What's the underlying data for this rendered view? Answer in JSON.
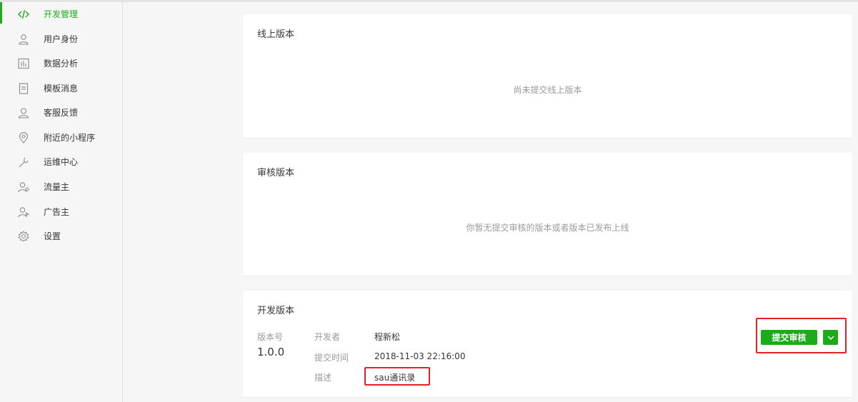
{
  "sidebar": {
    "items": [
      {
        "label": "开发管理",
        "icon": "code-icon",
        "active": true
      },
      {
        "label": "用户身份",
        "icon": "user-icon"
      },
      {
        "label": "数据分析",
        "icon": "bar-chart-icon"
      },
      {
        "label": "模板消息",
        "icon": "document-icon"
      },
      {
        "label": "客服反馈",
        "icon": "customer-service-icon"
      },
      {
        "label": "附近的小程序",
        "icon": "location-pin-icon"
      },
      {
        "label": "运维中心",
        "icon": "wrench-icon"
      },
      {
        "label": "流量主",
        "icon": "traffic-owner-icon"
      },
      {
        "label": "广告主",
        "icon": "advertiser-icon"
      },
      {
        "label": "设置",
        "icon": "gear-icon"
      }
    ]
  },
  "online": {
    "title": "线上版本",
    "empty_text": "尚未提交线上版本"
  },
  "review": {
    "title": "审核版本",
    "empty_text": "你暂无提交审核的版本或者版本已发布上线"
  },
  "dev": {
    "title": "开发版本",
    "version_label": "版本号",
    "version": "1.0.0",
    "developer_label": "开发者",
    "developer": "程新松",
    "submit_time_label": "提交时间",
    "submit_time": "2018-11-03 22:16:00",
    "desc_label": "描述",
    "desc": "sau通讯录",
    "submit_button": "提交审核"
  },
  "colors": {
    "accent": "#1aad19",
    "highlight": "#e32222"
  }
}
